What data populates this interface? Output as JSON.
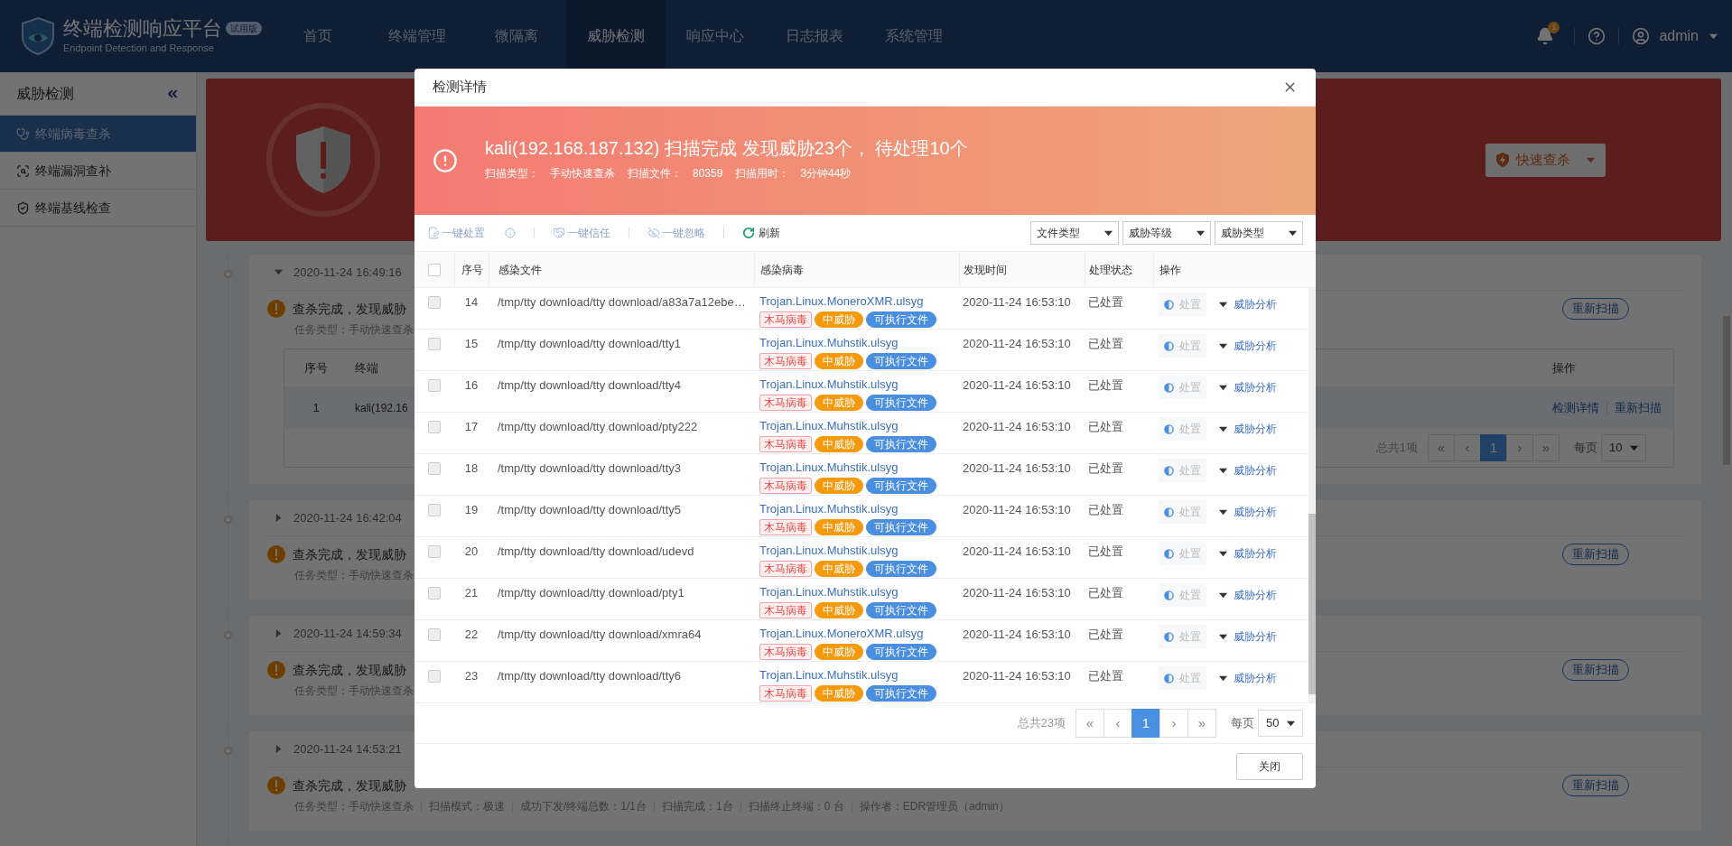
{
  "nav": {
    "title": "终端检测响应平台",
    "badge": "试用版",
    "subtitle": "Endpoint Detection and Response",
    "items": [
      {
        "label": "首页",
        "selected": false
      },
      {
        "label": "终端管理",
        "selected": false
      },
      {
        "label": "微隔离",
        "selected": false
      },
      {
        "label": "威胁检测",
        "selected": true
      },
      {
        "label": "响应中心",
        "selected": false
      },
      {
        "label": "日志报表",
        "selected": false
      },
      {
        "label": "系统管理",
        "selected": false
      }
    ],
    "notification_count": "1",
    "user": "admin"
  },
  "sidebar": {
    "title": "威胁检测",
    "items": [
      {
        "label": "终端病毒查杀",
        "selected": true
      },
      {
        "label": "终端漏洞查补",
        "selected": false
      },
      {
        "label": "终端基线检查",
        "selected": false
      }
    ]
  },
  "page": {
    "quick_scan_button": "快速查杀",
    "tasks": [
      {
        "time": "2020-11-24 16:49:16",
        "expanded": true,
        "summary": "查杀完成，发现威胁",
        "meta": [
          "任务类型：手动快速查杀"
        ],
        "rescan_button": "重新扫描",
        "table": {
          "columns": [
            "序号",
            "终端"
          ],
          "action_column": "操作",
          "rows": [
            {
              "index": "1",
              "terminal": "kali(192.16",
              "actions": [
                "检测详情",
                "重新扫描"
              ]
            }
          ],
          "total": "总共1项",
          "pages": [
            {
              "label": "«",
              "selected": false
            },
            {
              "label": "‹",
              "selected": false
            },
            {
              "label": "1",
              "selected": true
            },
            {
              "label": "›",
              "selected": false
            },
            {
              "label": "»",
              "selected": false
            }
          ],
          "per_page_label": "每页",
          "per_page": "10"
        }
      },
      {
        "time": "2020-11-24 16:42:04",
        "expanded": false,
        "summary": "查杀完成，发现威胁",
        "meta": [
          "任务类型：手动快速查杀"
        ],
        "rescan_button": "重新扫描"
      },
      {
        "time": "2020-11-24 14:59:34",
        "expanded": false,
        "summary": "查杀完成，发现威胁",
        "meta": [
          "任务类型：手动快速查杀"
        ],
        "rescan_button": "重新扫描"
      },
      {
        "time": "2020-11-24 14:53:21",
        "expanded": false,
        "summary": "查杀完成，发现威胁",
        "meta": [
          "任务类型：手动快速查杀",
          "扫描模式：极速",
          "成功下发/终端总数：1/1台",
          "扫描完成：1台",
          "扫描终止终端：0 台",
          "操作者：EDR管理员（admin）"
        ],
        "rescan_button": "重新扫描"
      }
    ]
  },
  "modal": {
    "title": "检测详情",
    "banner": {
      "title": "kali(192.168.187.132) 扫描完成 发现威胁23个， 待处理10个",
      "meta": [
        {
          "label": "扫描类型：",
          "value": "手动快速查杀"
        },
        {
          "label": "扫描文件：",
          "value": "80359"
        },
        {
          "label": "扫描用时：",
          "value": "3分钟44秒"
        }
      ]
    },
    "toolbar": {
      "actions": [
        {
          "label": "一键处置",
          "disabled": true
        },
        {
          "label": "一键信任",
          "disabled": true
        },
        {
          "label": "一键忽略",
          "disabled": true
        }
      ],
      "refresh": "刷新"
    },
    "filters": [
      "文件类型",
      "威胁等级",
      "威胁类型"
    ],
    "table": {
      "all_checked": false,
      "columns": [
        "序号",
        "感染文件",
        "感染病毒",
        "发现时间",
        "处理状态",
        "操作"
      ],
      "rows": [
        {
          "index": "14",
          "file": "/tmp/tty download/tty download/a83a7a12ebe…",
          "virus": "Trojan.Linux.MoneroXMR.ulsyg",
          "tags": [
            {
              "label": "木马病毒",
              "kind": "type"
            },
            {
              "label": "中威胁",
              "kind": "level"
            },
            {
              "label": "可执行文件",
              "kind": "file"
            }
          ],
          "time": "2020-11-24 16:53:10",
          "status": "已处置",
          "action": "处置",
          "link": "威胁分析",
          "checked": false
        },
        {
          "index": "15",
          "file": "/tmp/tty download/tty download/tty1",
          "virus": "Trojan.Linux.Muhstik.ulsyg",
          "tags": [
            {
              "label": "木马病毒",
              "kind": "type"
            },
            {
              "label": "中威胁",
              "kind": "level"
            },
            {
              "label": "可执行文件",
              "kind": "file"
            }
          ],
          "time": "2020-11-24 16:53:10",
          "status": "已处置",
          "action": "处置",
          "link": "威胁分析",
          "checked": false
        },
        {
          "index": "16",
          "file": "/tmp/tty download/tty download/tty4",
          "virus": "Trojan.Linux.Muhstik.ulsyg",
          "tags": [
            {
              "label": "木马病毒",
              "kind": "type"
            },
            {
              "label": "中威胁",
              "kind": "level"
            },
            {
              "label": "可执行文件",
              "kind": "file"
            }
          ],
          "time": "2020-11-24 16:53:10",
          "status": "已处置",
          "action": "处置",
          "link": "威胁分析",
          "checked": false
        },
        {
          "index": "17",
          "file": "/tmp/tty download/tty download/pty222",
          "virus": "Trojan.Linux.Muhstik.ulsyg",
          "tags": [
            {
              "label": "木马病毒",
              "kind": "type"
            },
            {
              "label": "中威胁",
              "kind": "level"
            },
            {
              "label": "可执行文件",
              "kind": "file"
            }
          ],
          "time": "2020-11-24 16:53:10",
          "status": "已处置",
          "action": "处置",
          "link": "威胁分析",
          "checked": false
        },
        {
          "index": "18",
          "file": "/tmp/tty download/tty download/tty3",
          "virus": "Trojan.Linux.Muhstik.ulsyg",
          "tags": [
            {
              "label": "木马病毒",
              "kind": "type"
            },
            {
              "label": "中威胁",
              "kind": "level"
            },
            {
              "label": "可执行文件",
              "kind": "file"
            }
          ],
          "time": "2020-11-24 16:53:10",
          "status": "已处置",
          "action": "处置",
          "link": "威胁分析",
          "checked": false
        },
        {
          "index": "19",
          "file": "/tmp/tty download/tty download/tty5",
          "virus": "Trojan.Linux.Muhstik.ulsyg",
          "tags": [
            {
              "label": "木马病毒",
              "kind": "type"
            },
            {
              "label": "中威胁",
              "kind": "level"
            },
            {
              "label": "可执行文件",
              "kind": "file"
            }
          ],
          "time": "2020-11-24 16:53:10",
          "status": "已处置",
          "action": "处置",
          "link": "威胁分析",
          "checked": false
        },
        {
          "index": "20",
          "file": "/tmp/tty download/tty download/udevd",
          "virus": "Trojan.Linux.Muhstik.ulsyg",
          "tags": [
            {
              "label": "木马病毒",
              "kind": "type"
            },
            {
              "label": "中威胁",
              "kind": "level"
            },
            {
              "label": "可执行文件",
              "kind": "file"
            }
          ],
          "time": "2020-11-24 16:53:10",
          "status": "已处置",
          "action": "处置",
          "link": "威胁分析",
          "checked": false
        },
        {
          "index": "21",
          "file": "/tmp/tty download/tty download/pty1",
          "virus": "Trojan.Linux.Muhstik.ulsyg",
          "tags": [
            {
              "label": "木马病毒",
              "kind": "type"
            },
            {
              "label": "中威胁",
              "kind": "level"
            },
            {
              "label": "可执行文件",
              "kind": "file"
            }
          ],
          "time": "2020-11-24 16:53:10",
          "status": "已处置",
          "action": "处置",
          "link": "威胁分析",
          "checked": false
        },
        {
          "index": "22",
          "file": "/tmp/tty download/tty download/xmra64",
          "virus": "Trojan.Linux.MoneroXMR.ulsyg",
          "tags": [
            {
              "label": "木马病毒",
              "kind": "type"
            },
            {
              "label": "中威胁",
              "kind": "level"
            },
            {
              "label": "可执行文件",
              "kind": "file"
            }
          ],
          "time": "2020-11-24 16:53:10",
          "status": "已处置",
          "action": "处置",
          "link": "威胁分析",
          "checked": false
        },
        {
          "index": "23",
          "file": "/tmp/tty download/tty download/tty6",
          "virus": "Trojan.Linux.Muhstik.ulsyg",
          "tags": [
            {
              "label": "木马病毒",
              "kind": "type"
            },
            {
              "label": "中威胁",
              "kind": "level"
            },
            {
              "label": "可执行文件",
              "kind": "file"
            }
          ],
          "time": "2020-11-24 16:53:10",
          "status": "已处置",
          "action": "处置",
          "link": "威胁分析",
          "checked": false
        }
      ]
    },
    "pagination": {
      "total": "总共23项",
      "pages": [
        {
          "label": "«",
          "selected": false
        },
        {
          "label": "‹",
          "selected": false
        },
        {
          "label": "1",
          "selected": true
        },
        {
          "label": "›",
          "selected": false
        },
        {
          "label": "»",
          "selected": false
        }
      ],
      "per_page_label": "每页",
      "per_page": "50"
    },
    "close_button": "关闭"
  }
}
